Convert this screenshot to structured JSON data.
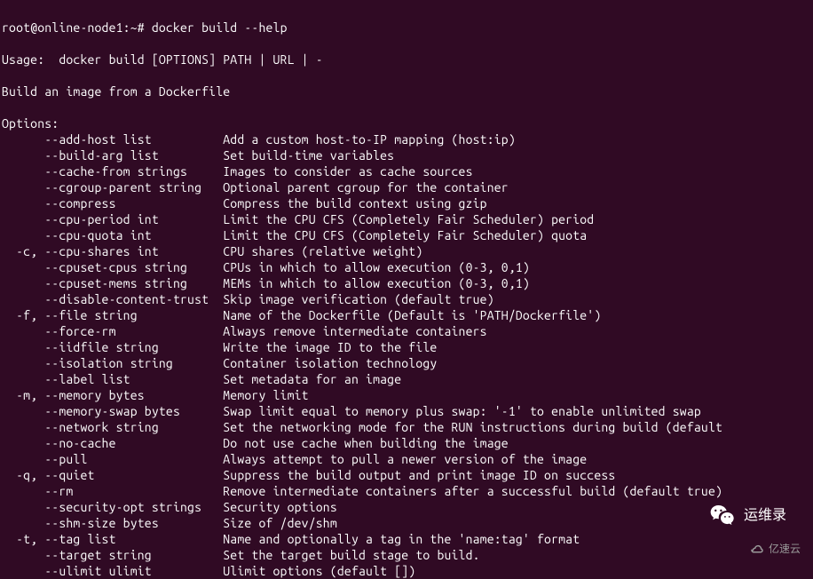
{
  "prompt": "root@online-node1:~# ",
  "command": "docker build --help",
  "usage_label": "Usage:  ",
  "usage": "docker build [OPTIONS] PATH | URL | -",
  "description": "Build an image from a Dockerfile",
  "options_header": "Options:",
  "options": [
    {
      "short": "  ",
      "flag": "      --add-host list          ",
      "desc": "Add a custom host-to-IP mapping (host:ip)"
    },
    {
      "short": "  ",
      "flag": "      --build-arg list         ",
      "desc": "Set build-time variables"
    },
    {
      "short": "  ",
      "flag": "      --cache-from strings     ",
      "desc": "Images to consider as cache sources"
    },
    {
      "short": "  ",
      "flag": "      --cgroup-parent string   ",
      "desc": "Optional parent cgroup for the container"
    },
    {
      "short": "  ",
      "flag": "      --compress               ",
      "desc": "Compress the build context using gzip"
    },
    {
      "short": "  ",
      "flag": "      --cpu-period int         ",
      "desc": "Limit the CPU CFS (Completely Fair Scheduler) period"
    },
    {
      "short": "  ",
      "flag": "      --cpu-quota int          ",
      "desc": "Limit the CPU CFS (Completely Fair Scheduler) quota"
    },
    {
      "short": "  ",
      "flag": "  -c, --cpu-shares int         ",
      "desc": "CPU shares (relative weight)"
    },
    {
      "short": "  ",
      "flag": "      --cpuset-cpus string     ",
      "desc": "CPUs in which to allow execution (0-3, 0,1)"
    },
    {
      "short": "  ",
      "flag": "      --cpuset-mems string     ",
      "desc": "MEMs in which to allow execution (0-3, 0,1)"
    },
    {
      "short": "  ",
      "flag": "      --disable-content-trust  ",
      "desc": "Skip image verification (default true)"
    },
    {
      "short": "  ",
      "flag": "  -f, --file string            ",
      "desc": "Name of the Dockerfile (Default is 'PATH/Dockerfile')"
    },
    {
      "short": "  ",
      "flag": "      --force-rm               ",
      "desc": "Always remove intermediate containers"
    },
    {
      "short": "  ",
      "flag": "      --iidfile string         ",
      "desc": "Write the image ID to the file"
    },
    {
      "short": "  ",
      "flag": "      --isolation string       ",
      "desc": "Container isolation technology"
    },
    {
      "short": "  ",
      "flag": "      --label list             ",
      "desc": "Set metadata for an image"
    },
    {
      "short": "  ",
      "flag": "  -m, --memory bytes           ",
      "desc": "Memory limit"
    },
    {
      "short": "  ",
      "flag": "      --memory-swap bytes      ",
      "desc": "Swap limit equal to memory plus swap: '-1' to enable unlimited swap"
    },
    {
      "short": "  ",
      "flag": "      --network string         ",
      "desc": "Set the networking mode for the RUN instructions during build (default"
    },
    {
      "short": "  ",
      "flag": "      --no-cache               ",
      "desc": "Do not use cache when building the image"
    },
    {
      "short": "  ",
      "flag": "      --pull                   ",
      "desc": "Always attempt to pull a newer version of the image"
    },
    {
      "short": "  ",
      "flag": "  -q, --quiet                  ",
      "desc": "Suppress the build output and print image ID on success"
    },
    {
      "short": "  ",
      "flag": "      --rm                     ",
      "desc": "Remove intermediate containers after a successful build (default true)"
    },
    {
      "short": "  ",
      "flag": "      --security-opt strings   ",
      "desc": "Security options"
    },
    {
      "short": "  ",
      "flag": "      --shm-size bytes         ",
      "desc": "Size of /dev/shm"
    },
    {
      "short": "  ",
      "flag": "  -t, --tag list               ",
      "desc": "Name and optionally a tag in the 'name:tag' format"
    },
    {
      "short": "  ",
      "flag": "      --target string          ",
      "desc": "Set the target build stage to build."
    },
    {
      "short": "  ",
      "flag": "      --ulimit ulimit          ",
      "desc": "Ulimit options (default [])"
    }
  ],
  "wechat_label": "运维录",
  "yisu_label": "亿速云"
}
